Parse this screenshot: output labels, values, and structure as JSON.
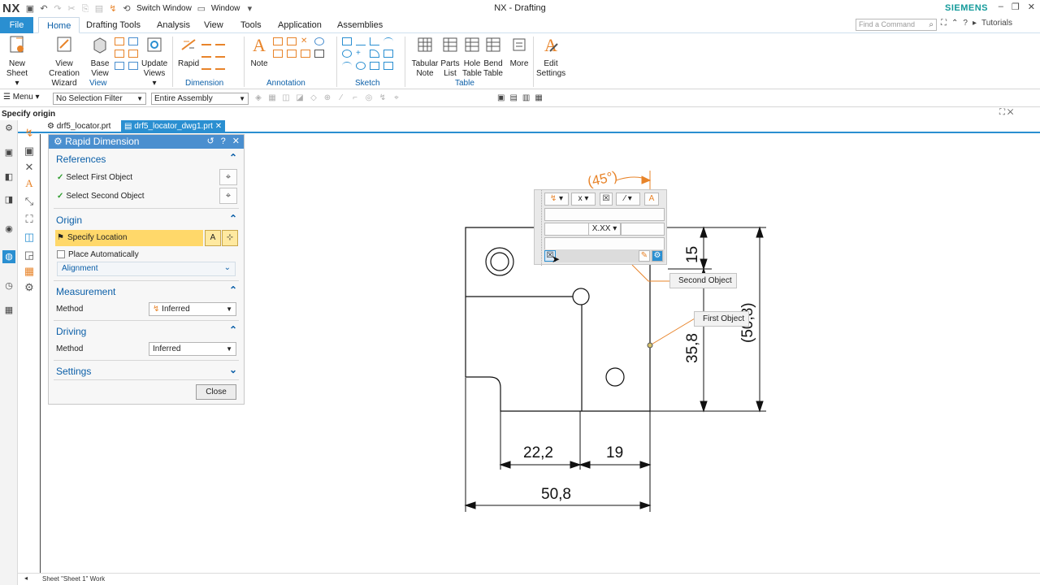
{
  "app": {
    "logo": "NX",
    "title": "NX - Drafting",
    "brand": "SIEMENS",
    "switch_window": "Switch Window",
    "window_menu": "Window",
    "find_command_placeholder": "Find a Command",
    "tutorials": "Tutorials"
  },
  "ribbon_tabs": [
    "File",
    "Home",
    "Drafting Tools",
    "Analysis",
    "View",
    "Tools",
    "Application",
    "Assemblies"
  ],
  "ribbon": {
    "new_sheet": [
      "New",
      "Sheet ▾"
    ],
    "view_creation_wizard": [
      "View Creation",
      "Wizard"
    ],
    "base_view": [
      "Base",
      "View"
    ],
    "update_views": [
      "Update",
      "Views ▾"
    ],
    "rapid": "Rapid",
    "note": "Note",
    "tabular_note": [
      "Tabular",
      "Note"
    ],
    "parts_list": [
      "Parts",
      "List"
    ],
    "hole_table": [
      "Hole",
      "Table"
    ],
    "bend_table": [
      "Bend",
      "Table"
    ],
    "more": "More",
    "edit_settings": [
      "Edit",
      "Settings"
    ],
    "groups": [
      "View",
      "Dimension",
      "Annotation",
      "Sketch",
      "Table"
    ]
  },
  "selection_bar": {
    "menu": "Menu ▾",
    "filter": "No Selection Filter",
    "scope": "Entire Assembly"
  },
  "cue_line": "Specify origin",
  "doc_tabs": [
    "drf5_locator.prt",
    "drf5_locator_dwg1.prt"
  ],
  "dialog": {
    "title": "Rapid Dimension",
    "references": {
      "title": "References",
      "first": "Select First Object",
      "second": "Select Second Object"
    },
    "origin": {
      "title": "Origin",
      "specify_location": "Specify Location",
      "place_automatically": "Place Automatically",
      "alignment": "Alignment"
    },
    "measurement": {
      "title": "Measurement",
      "method_label": "Method",
      "method_value": "Inferred"
    },
    "driving": {
      "title": "Driving",
      "method_label": "Method",
      "method_value": "Inferred"
    },
    "settings": {
      "title": "Settings"
    },
    "close": "Close"
  },
  "float_toolbar": {
    "x_option": "x",
    "precision": "X.XX"
  },
  "drawing": {
    "dims": [
      "22,2",
      "19",
      "50,8",
      "15",
      "35,8",
      "(50,8)"
    ],
    "preview_dim": "(45°)",
    "tags": [
      "Second Object",
      "First Object"
    ]
  },
  "status_bar": "Sheet \"Sheet 1\" Work",
  "colors": {
    "accent": "#2a8fd1",
    "highlight": "#ffd86a",
    "dim_orange": "#e8842a",
    "section_blue": "#0b5fa8"
  }
}
